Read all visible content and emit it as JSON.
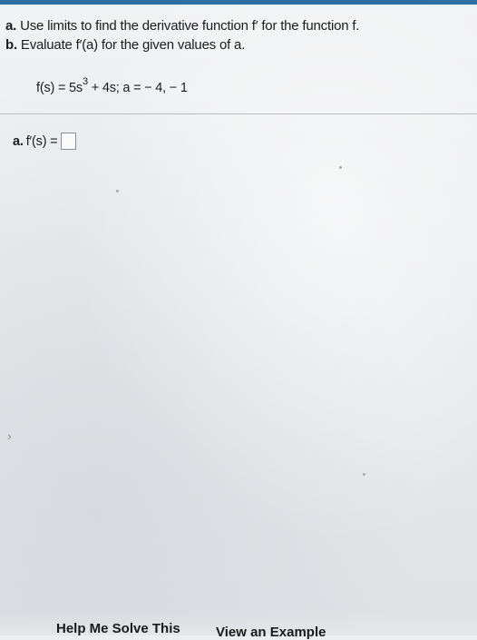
{
  "question": {
    "part_a_label": "a.",
    "part_a_text": "Use limits to find the derivative function f′ for the function f.",
    "part_b_label": "b.",
    "part_b_text": "Evaluate f′(a) for the given values of a."
  },
  "formula": {
    "lhs": "f(s) = 5s",
    "exponent": "3",
    "rhs": " + 4s; a = − 4, − 1"
  },
  "answer": {
    "label": "a.",
    "expression": "f′(s) ="
  },
  "icons": {
    "left_nav": "chevron-right-icon"
  },
  "colors": {
    "accent_stripe": "#2d6fa3"
  },
  "footer": {
    "help_label": "Help Me Solve This",
    "example_label": "View an Example"
  }
}
